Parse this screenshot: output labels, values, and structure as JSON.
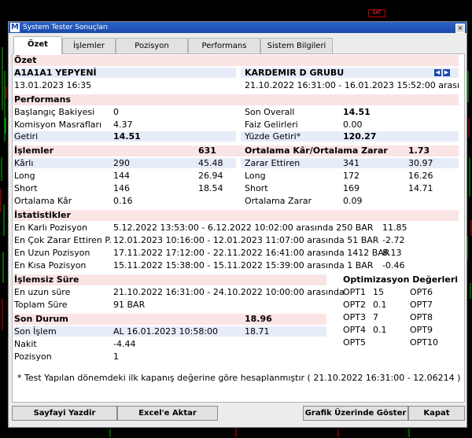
{
  "window": {
    "title": "System Tester Sonuçları",
    "app_icon_letter": "M",
    "close_glyph": "×"
  },
  "chart_bg": {
    "badge": "SAT",
    "colors": {
      "green": "#00c000",
      "red": "#e00000"
    }
  },
  "tabs": [
    "Özet",
    "İşlemler",
    "Pozisyon",
    "Performans",
    "Sistem Bilgileri"
  ],
  "summary": {
    "header": "Özet",
    "symbol": "A1A1A1 YEPYENİ",
    "symbol_date": "13.01.2023 16:35",
    "company": "KARDEMIR D GRUBU",
    "range": "21.10.2022 16:31:00 - 16.01.2023 15:52:00 arası",
    "nav_prev": "◀",
    "nav_next": "▶"
  },
  "performance": {
    "header": "Performans",
    "left": [
      {
        "label": "Başlangıç Bakiyesi",
        "value": "0"
      },
      {
        "label": "Komisyon Masrafları",
        "value": "4.37"
      },
      {
        "label": "Getiri",
        "value": "14.51"
      }
    ],
    "right": [
      {
        "label": "Son Overall",
        "value": "14.51"
      },
      {
        "label": "Faiz Gelirleri",
        "value": "0.00"
      },
      {
        "label": "Yüzde Getiri*",
        "value": "120.27"
      }
    ]
  },
  "trades": {
    "header": "İşlemler",
    "header_value": "631",
    "right_header": "Ortalama Kâr/Ortalama Zarar",
    "right_header_value": "1.73",
    "rows": [
      {
        "l_label": "Kârlı",
        "l_v1": "290",
        "l_v2": "45.48",
        "r_label": "Zarar Ettiren",
        "r_v1": "341",
        "r_v2": "30.97"
      },
      {
        "l_label": "Long",
        "l_v1": "144",
        "l_v2": "26.94",
        "r_label": "Long",
        "r_v1": "172",
        "r_v2": "16.26"
      },
      {
        "l_label": "Short",
        "l_v1": "146",
        "l_v2": "18.54",
        "r_label": "Short",
        "r_v1": "169",
        "r_v2": "14.71"
      },
      {
        "l_label": "Ortalama Kâr",
        "l_v1": "0.16",
        "l_v2": "",
        "r_label": "Ortalama Zarar",
        "r_v1": "0.09",
        "r_v2": ""
      }
    ]
  },
  "stats": {
    "header": "İstatistikler",
    "rows": [
      {
        "label": "En Karlı Pozisyon",
        "range": "5.12.2022 13:53:00 - 6.12.2022 10:02:00 arasında 250 BAR",
        "value": "11.85"
      },
      {
        "label": "En Çok Zarar Ettiren P.",
        "range": "12.01.2023 10:16:00 - 12.01.2023 11:07:00 arasında 51 BAR",
        "value": "-2.72"
      },
      {
        "label": "En Uzun Pozisyon",
        "range": "17.11.2022 17:12:00 - 22.11.2022 16:41:00 arasında 1412 BAR",
        "value": "8.13"
      },
      {
        "label": "En Kısa Pozisyon",
        "range": "15.11.2022 15:38:00 - 15.11.2022 15:39:00 arasında 1 BAR",
        "value": "-0.46"
      }
    ]
  },
  "idle": {
    "header": "İşlemsiz Süre",
    "longest_label": "En uzun süre",
    "longest_value": "21.10.2022 16:31:00 - 24.10.2022 10:00:00 arasında",
    "total_label": "Toplam Süre",
    "total_value": "91 BAR"
  },
  "last_state": {
    "header": "Son Durum",
    "header_value": "18.96",
    "rows": [
      {
        "label": "Son İşlem",
        "value": "AL  16.01.2023 10:58:00",
        "extra": "18.71"
      },
      {
        "label": "Nakit",
        "value": "-4.44",
        "extra": ""
      },
      {
        "label": "Pozisyon",
        "value": "1",
        "extra": ""
      }
    ]
  },
  "optimization": {
    "header": "Optimizasyon Değerleri",
    "left": [
      {
        "name": "OPT1",
        "value": "15"
      },
      {
        "name": "OPT2",
        "value": "0.1"
      },
      {
        "name": "OPT3",
        "value": "7"
      },
      {
        "name": "OPT4",
        "value": "0.1"
      },
      {
        "name": "OPT5",
        "value": ""
      }
    ],
    "right": [
      {
        "name": "OPT6",
        "value": ""
      },
      {
        "name": "OPT7",
        "value": ""
      },
      {
        "name": "OPT8",
        "value": ""
      },
      {
        "name": "OPT9",
        "value": ""
      },
      {
        "name": "OPT10",
        "value": ""
      }
    ]
  },
  "footnote": "* Test Yapılan dönemdeki ilk kapanış değerine göre hesaplanmıştır ( 21.10.2022 16:31:00 - 12.06214 )",
  "buttons": {
    "print": "Sayfayi Yazdir",
    "excel": "Excel'e Aktar",
    "chart": "Grafik Üzerinde Göster",
    "close": "Kapat"
  }
}
